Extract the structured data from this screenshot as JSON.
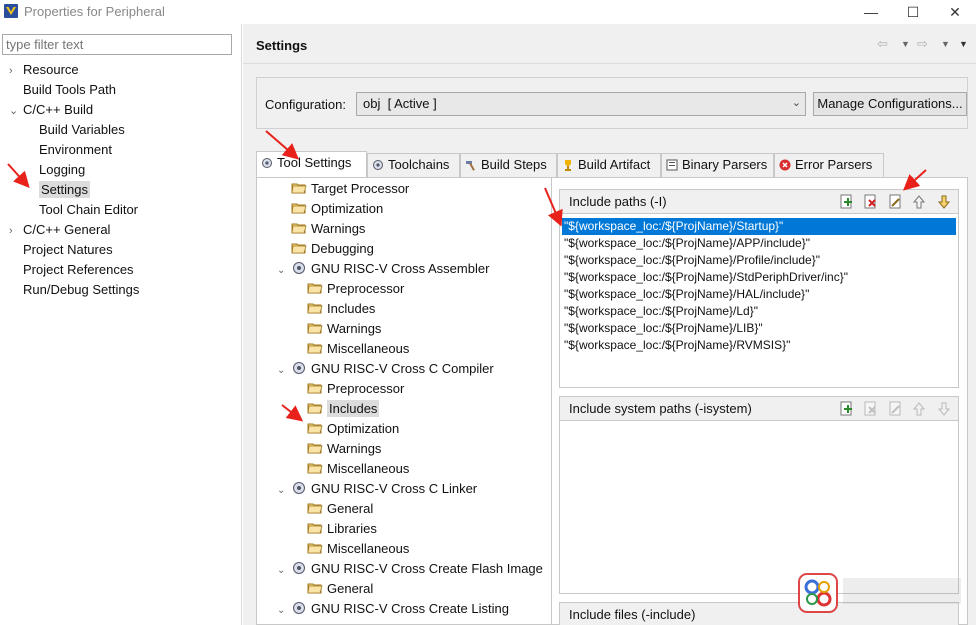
{
  "window": {
    "title": "Properties for Peripheral"
  },
  "filter": {
    "placeholder": "type filter text"
  },
  "left_tree": [
    {
      "label": "Resource",
      "indent": 0,
      "arrow": "›",
      "selected": false
    },
    {
      "label": "Build Tools Path",
      "indent": 0,
      "arrow": "",
      "selected": false
    },
    {
      "label": "C/C++ Build",
      "indent": 0,
      "arrow": "⌄",
      "selected": false
    },
    {
      "label": "Build Variables",
      "indent": 1,
      "arrow": "",
      "selected": false
    },
    {
      "label": "Environment",
      "indent": 1,
      "arrow": "",
      "selected": false
    },
    {
      "label": "Logging",
      "indent": 1,
      "arrow": "",
      "selected": false
    },
    {
      "label": "Settings",
      "indent": 1,
      "arrow": "",
      "selected": true
    },
    {
      "label": "Tool Chain Editor",
      "indent": 1,
      "arrow": "",
      "selected": false
    },
    {
      "label": "C/C++ General",
      "indent": 0,
      "arrow": "›",
      "selected": false
    },
    {
      "label": "Project Natures",
      "indent": 0,
      "arrow": "",
      "selected": false
    },
    {
      "label": "Project References",
      "indent": 0,
      "arrow": "",
      "selected": false
    },
    {
      "label": "Run/Debug Settings",
      "indent": 0,
      "arrow": "",
      "selected": false
    }
  ],
  "settings": {
    "title": "Settings",
    "configuration_label": "Configuration:",
    "configuration_value": "obj  [ Active ]",
    "manage_button": "Manage Configurations..."
  },
  "tabs": [
    {
      "label": "Tool Settings",
      "icon": "gear-icon",
      "active": true
    },
    {
      "label": "Toolchains",
      "icon": "gear-icon",
      "active": false
    },
    {
      "label": "Build Steps",
      "icon": "hammer-icon",
      "active": false
    },
    {
      "label": "Build Artifact",
      "icon": "trophy-icon",
      "active": false
    },
    {
      "label": "Binary Parsers",
      "icon": "binary-icon",
      "active": false
    },
    {
      "label": "Error Parsers",
      "icon": "error-icon",
      "active": false
    }
  ],
  "tool_tree": [
    {
      "label": "Target Processor",
      "level": 0,
      "type": "folder",
      "arrow": ""
    },
    {
      "label": "Optimization",
      "level": 0,
      "type": "folder",
      "arrow": ""
    },
    {
      "label": "Warnings",
      "level": 0,
      "type": "folder",
      "arrow": ""
    },
    {
      "label": "Debugging",
      "level": 0,
      "type": "folder",
      "arrow": ""
    },
    {
      "label": "GNU RISC-V Cross Assembler",
      "level": 0,
      "type": "tool",
      "arrow": "⌄"
    },
    {
      "label": "Preprocessor",
      "level": 1,
      "type": "folder",
      "arrow": ""
    },
    {
      "label": "Includes",
      "level": 1,
      "type": "folder",
      "arrow": ""
    },
    {
      "label": "Warnings",
      "level": 1,
      "type": "folder",
      "arrow": ""
    },
    {
      "label": "Miscellaneous",
      "level": 1,
      "type": "folder",
      "arrow": ""
    },
    {
      "label": "GNU RISC-V Cross C Compiler",
      "level": 0,
      "type": "tool",
      "arrow": "⌄"
    },
    {
      "label": "Preprocessor",
      "level": 1,
      "type": "folder",
      "arrow": ""
    },
    {
      "label": "Includes",
      "level": 1,
      "type": "folder",
      "arrow": "",
      "selected": true
    },
    {
      "label": "Optimization",
      "level": 1,
      "type": "folder",
      "arrow": ""
    },
    {
      "label": "Warnings",
      "level": 1,
      "type": "folder",
      "arrow": ""
    },
    {
      "label": "Miscellaneous",
      "level": 1,
      "type": "folder",
      "arrow": ""
    },
    {
      "label": "GNU RISC-V Cross C Linker",
      "level": 0,
      "type": "tool",
      "arrow": "⌄"
    },
    {
      "label": "General",
      "level": 1,
      "type": "folder",
      "arrow": ""
    },
    {
      "label": "Libraries",
      "level": 1,
      "type": "folder",
      "arrow": ""
    },
    {
      "label": "Miscellaneous",
      "level": 1,
      "type": "folder",
      "arrow": ""
    },
    {
      "label": "GNU RISC-V Cross Create Flash Image",
      "level": 0,
      "type": "tool",
      "arrow": "⌄"
    },
    {
      "label": "General",
      "level": 1,
      "type": "folder",
      "arrow": ""
    },
    {
      "label": "GNU RISC-V Cross Create Listing",
      "level": 0,
      "type": "tool",
      "arrow": "⌄"
    }
  ],
  "include_paths": {
    "title": "Include paths (-I)",
    "items": [
      "\"${workspace_loc:/${ProjName}/Startup}\"",
      "\"${workspace_loc:/${ProjName}/APP/include}\"",
      "\"${workspace_loc:/${ProjName}/Profile/include}\"",
      "\"${workspace_loc:/${ProjName}/StdPeriphDriver/inc}\"",
      "\"${workspace_loc:/${ProjName}/HAL/include}\"",
      "\"${workspace_loc:/${ProjName}/Ld}\"",
      "\"${workspace_loc:/${ProjName}/LIB}\"",
      "\"${workspace_loc:/${ProjName}/RVMSIS}\""
    ]
  },
  "include_system_paths": {
    "title": "Include system paths (-isystem)"
  },
  "include_files": {
    "title": "Include files (-include)"
  },
  "colors": {
    "selection": "#0078d7",
    "annotation": "#e8211a"
  }
}
